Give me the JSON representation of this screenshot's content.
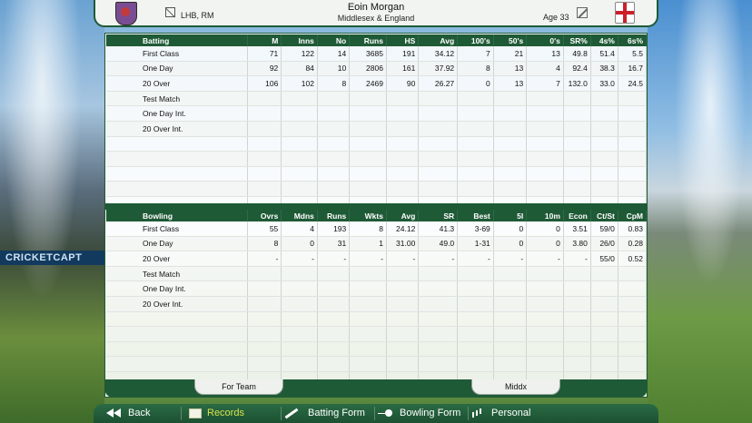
{
  "header": {
    "player_name": "Eoin Morgan",
    "team": "Middlesex & England",
    "bat_style": "LHB, RM",
    "age": "Age 33"
  },
  "banner": {
    "text": "CRICKETCAPT"
  },
  "batting": {
    "columns": [
      "Batting",
      "M",
      "Inns",
      "No",
      "Runs",
      "HS",
      "Avg",
      "100's",
      "50's",
      "0's",
      "SR%",
      "4s%",
      "6s%"
    ],
    "rows": [
      [
        "First Class",
        "71",
        "122",
        "14",
        "3685",
        "191",
        "34.12",
        "7",
        "21",
        "13",
        "49.8",
        "51.4",
        "5.5"
      ],
      [
        "One Day",
        "92",
        "84",
        "10",
        "2806",
        "161",
        "37.92",
        "8",
        "13",
        "4",
        "92.4",
        "38.3",
        "16.7"
      ],
      [
        "20 Over",
        "106",
        "102",
        "8",
        "2469",
        "90",
        "26.27",
        "0",
        "13",
        "7",
        "132.0",
        "33.0",
        "24.5"
      ],
      [
        "Test Match",
        "",
        "",
        "",
        "",
        "",
        "",
        "",
        "",
        "",
        "",
        "",
        ""
      ],
      [
        "One Day Int.",
        "",
        "",
        "",
        "",
        "",
        "",
        "",
        "",
        "",
        "",
        "",
        ""
      ],
      [
        "20 Over Int.",
        "",
        "",
        "",
        "",
        "",
        "",
        "",
        "",
        "",
        "",
        "",
        ""
      ]
    ]
  },
  "bowling": {
    "columns": [
      "Bowling",
      "Ovrs",
      "Mdns",
      "Runs",
      "Wkts",
      "Avg",
      "SR",
      "Best",
      "5I",
      "10m",
      "Econ",
      "Ct/St",
      "CpM"
    ],
    "rows": [
      [
        "First Class",
        "55",
        "4",
        "193",
        "8",
        "24.12",
        "41.3",
        "3-69",
        "0",
        "0",
        "3.51",
        "59/0",
        "0.83"
      ],
      [
        "One Day",
        "8",
        "0",
        "31",
        "1",
        "31.00",
        "49.0",
        "1-31",
        "0",
        "0",
        "3.80",
        "26/0",
        "0.28"
      ],
      [
        "20 Over",
        "-",
        "-",
        "-",
        "-",
        "-",
        "-",
        "-",
        "-",
        "-",
        "-",
        "55/0",
        "0.52"
      ],
      [
        "Test Match",
        "",
        "",
        "",
        "",
        "",
        "",
        "",
        "",
        "",
        "",
        "",
        ""
      ],
      [
        "One Day Int.",
        "",
        "",
        "",
        "",
        "",
        "",
        "",
        "",
        "",
        "",
        "",
        ""
      ],
      [
        "20 Over Int.",
        "",
        "",
        "",
        "",
        "",
        "",
        "",
        "",
        "",
        "",
        "",
        ""
      ]
    ]
  },
  "panel_tabs": {
    "left": "For Team",
    "right": "Middx"
  },
  "nav": {
    "back": "Back",
    "records": "Records",
    "batting_form": "Batting Form",
    "bowling_form": "Bowling Form",
    "personal": "Personal"
  },
  "colors": {
    "accent_green": "#1f5a36",
    "active_tab_text": "#d7e34a"
  }
}
